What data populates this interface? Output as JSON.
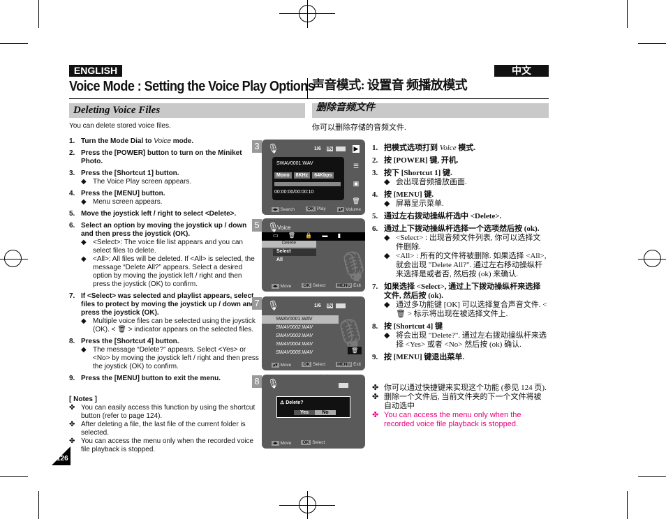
{
  "header": {
    "lang_en": "ENGLISH",
    "lang_cn": "中文",
    "title_en": "Voice Mode : Setting the Voice Play Options",
    "title_cn": "声音模式: 设置音 频播放模式"
  },
  "section": {
    "en": "Deleting Voice Files",
    "cn": "删除音频文件"
  },
  "en": {
    "intro": "You can delete stored voice files.",
    "steps": [
      {
        "n": "1.",
        "pre": "Turn the Mode Dial to ",
        "em": "Voice",
        "post": " mode."
      },
      {
        "n": "2.",
        "text": "Press the [POWER] button to turn on the Miniket Photo."
      },
      {
        "n": "3.",
        "text": "Press the [Shortcut 1] button.",
        "subs": [
          "The Voice Play screen appears."
        ]
      },
      {
        "n": "4.",
        "text": "Press the [MENU] button.",
        "subs": [
          "Menu screen appears."
        ]
      },
      {
        "n": "5.",
        "text": "Move the joystick left / right to select <Delete>."
      },
      {
        "n": "6.",
        "text": "Select an option by moving the joystick up / down and then press the joystick (OK).",
        "subs": [
          "<Select>: The voice file list appears and you can select files to delete.",
          "<All>: All files will be deleted. If <All> is selected, the message “Delete All?” appears. Select a desired option by moving the joystick left / right and then press the joystick (OK) to confirm."
        ]
      },
      {
        "n": "7.",
        "text": "If <Select> was selected and playlist appears, select files to protect by moving the joystick up / down and press the joystick (OK).",
        "subs": [
          "Multiple voice files can be selected using the joystick (OK). < 🗑 > indicator appears on the selected files."
        ]
      },
      {
        "n": "8.",
        "text": "Press the [Shortcut 4] button.",
        "subs": [
          "The message “Delete?” appears. Select <Yes> or <No> by moving the joystick left / right and then press the joystick (OK) to confirm."
        ]
      },
      {
        "n": "9.",
        "text": "Press the [MENU] button to exit the menu."
      }
    ],
    "notes_title": "[ Notes ]",
    "notes": [
      "You can easily access this function by using the shortcut button (refer to page 124).",
      "After deleting a file, the last file of the current folder is selected.",
      "You can access the menu only when the recorded voice file playback is stopped."
    ]
  },
  "cn": {
    "intro": "你可以删除存储的音频文件.",
    "steps": [
      {
        "n": "1.",
        "pre": "把模式选项打到 ",
        "em": "Voice",
        "post": " 模式."
      },
      {
        "n": "2.",
        "text": "按 [POWER] 键, 开机."
      },
      {
        "n": "3.",
        "text": "按下 [Shortcut 1] 键.",
        "subs": [
          "会出现音频播放画面."
        ]
      },
      {
        "n": "4.",
        "text": "按 [MENU] 键.",
        "subs": [
          "屏幕显示菜单."
        ]
      },
      {
        "n": "5.",
        "text": "通过左右拨动操纵杆选中 <Delete>."
      },
      {
        "n": "6.",
        "text": "通过上下拨动操纵杆选择一个选项然后按 (ok).",
        "subs": [
          "<Select> : 出现音频文件列表, 你可以选择文件删除.",
          "<All> : 所有的文件将被删除. 如果选择 <All>, 就会出现 \"Delete All?\". 通过左右移动操纵杆来选择是或者否, 然后按 (ok) 来确认."
        ]
      },
      {
        "n": "7.",
        "text": "如果选择 <Select>, 通过上下拨动操纵杆来选择文件, 然后按 (ok).",
        "subs": [
          "通过多功能键 [OK] 可以选择复合声音文件. < 🗑 > 标示将出现在被选择文件上."
        ]
      },
      {
        "n": "8.",
        "text": "按 [Shortcut 4] 键",
        "subs": [
          "将会出现 \"Delete?\". 通过左右拨动操纵杆来选择 <Yes> 或者 <No> 然后按 (ok) 确认."
        ]
      },
      {
        "n": "9.",
        "text": "按 [MENU] 键退出菜单."
      }
    ],
    "notes_title": "[ 注意]",
    "notes": [
      "你可以通过快捷键来实现这个功能 (参见 124 页).",
      "删除一个文件后, 当前文件夹的下一个文件将被自动选中"
    ],
    "note_highlight": "You can access the menu only when the recorded voice file playback is stopped."
  },
  "screens": {
    "s3": {
      "num": "3",
      "counter": "1/6",
      "mem": "IN",
      "file": "SWAV0001.WAV",
      "chips": [
        "Mono",
        "8KHz",
        "64Kbps"
      ],
      "time": "00:00:00/00:00:10",
      "foot": [
        "Search",
        "Play",
        "Volume"
      ],
      "keys": [
        "◂▸",
        "OK",
        "▴▾"
      ]
    },
    "s5": {
      "num": "5",
      "mode": "Voice",
      "item": "Delete",
      "options": [
        "Select",
        "All"
      ],
      "foot": [
        "Move",
        "Select",
        "Exit"
      ],
      "keys": [
        "◂▸",
        "OK",
        "MENU"
      ]
    },
    "s7": {
      "num": "7",
      "counter": "1/6",
      "mem": "IN",
      "files": [
        "SWAV0001.WAV",
        "SWAV0002.WAV",
        "SWAV0003.WAV",
        "SWAV0004.WAV",
        "SWAV0005.WAV"
      ],
      "foot": [
        "Move",
        "Select",
        "Exit"
      ],
      "keys": [
        "▴▾",
        "OK",
        "MENU"
      ]
    },
    "s8": {
      "num": "8",
      "dialog": "Delete?",
      "yes": "Yes",
      "no": "No",
      "foot": [
        "Move",
        "Select"
      ],
      "keys": [
        "◂▸",
        "OK"
      ]
    }
  },
  "page_number": "126",
  "colors": {
    "highlight": "#e6007e",
    "section_bar": "#c9c9c9"
  }
}
